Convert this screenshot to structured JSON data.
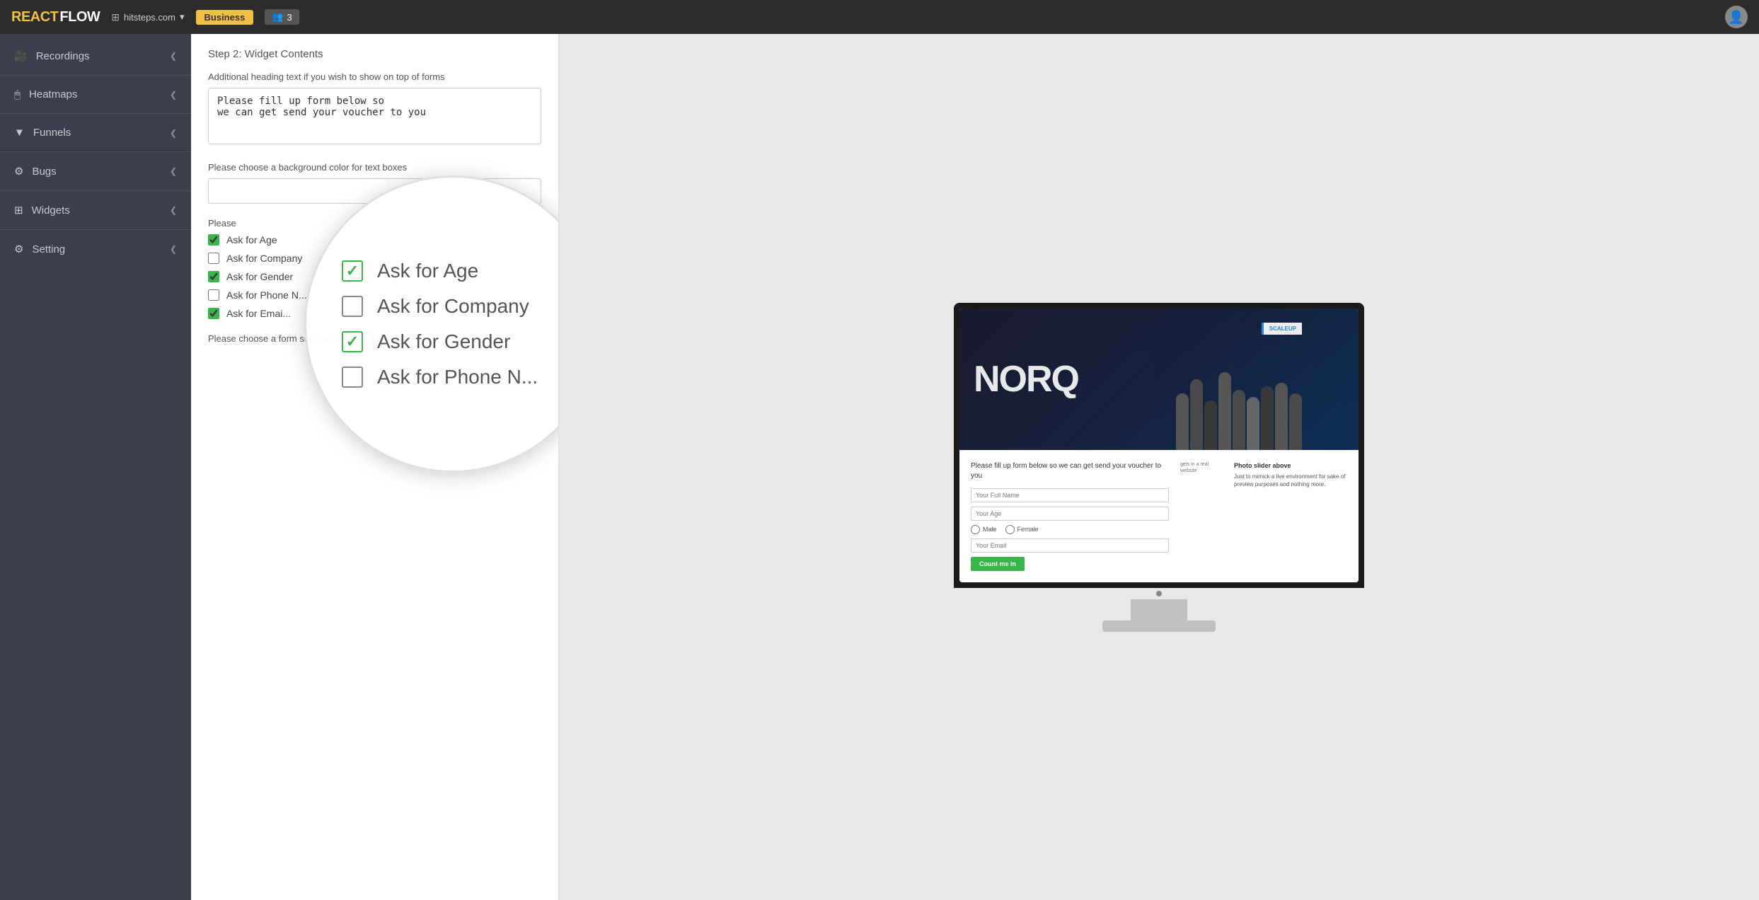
{
  "app": {
    "logo_react": "REACT",
    "logo_flow": "FLOW",
    "site_name": "hitsteps.com",
    "plan_badge": "Business",
    "users_count": "3"
  },
  "sidebar": {
    "items": [
      {
        "id": "recordings",
        "label": "Recordings",
        "icon": "🎥",
        "active": false
      },
      {
        "id": "heatmaps",
        "label": "Heatmaps",
        "icon": "🖱",
        "active": false
      },
      {
        "id": "funnels",
        "label": "Funnels",
        "icon": "⬇",
        "active": false
      },
      {
        "id": "bugs",
        "label": "Bugs",
        "icon": "⚙",
        "active": false
      },
      {
        "id": "widgets",
        "label": "Widgets",
        "icon": "⚙",
        "active": false
      },
      {
        "id": "setting",
        "label": "Setting",
        "icon": "⚙",
        "active": false
      }
    ]
  },
  "form_editor": {
    "step_title": "Step 2: Widget Contents",
    "heading_label": "Additional heading text if you wish to show on top of forms",
    "heading_value": "Please fill up form below so\nwe can get send your voucher to you",
    "bg_color_label": "Please choose a background color for text boxes",
    "bg_color_value": "",
    "fields_label": "Please",
    "checkboxes": [
      {
        "id": "age",
        "label": "Ask for Age",
        "checked": true
      },
      {
        "id": "company",
        "label": "Ask for Company",
        "checked": false
      },
      {
        "id": "gender",
        "label": "Ask for Gender",
        "checked": true
      },
      {
        "id": "phone",
        "label": "Ask for Phone N...",
        "checked": false
      },
      {
        "id": "email",
        "label": "Ask for Emai...",
        "checked": true
      }
    ],
    "submit_label": "Please choose a form submission button to submit"
  },
  "magnifier": {
    "items": [
      {
        "label": "Ask for Age",
        "checked": true
      },
      {
        "label": "Ask for Company",
        "checked": false
      },
      {
        "label": "Ask for Gender",
        "checked": true
      },
      {
        "label": "Ask for Phone N...",
        "checked": false
      }
    ]
  },
  "preview": {
    "hero_text": "NORQ",
    "form_heading": "Please fill up form below so\nwe can get send your voucher to you",
    "full_name_placeholder": "Your Full Name",
    "age_placeholder": "Your Age",
    "email_placeholder": "Your Email",
    "male_label": "Male",
    "female_label": "Female",
    "submit_btn": "Count me in",
    "aside_title": "Photo slider above",
    "aside_text": "Just to mimick a live environment for sake of preview purposes and nothing more.",
    "sidebar_text": "gets in a real website"
  }
}
